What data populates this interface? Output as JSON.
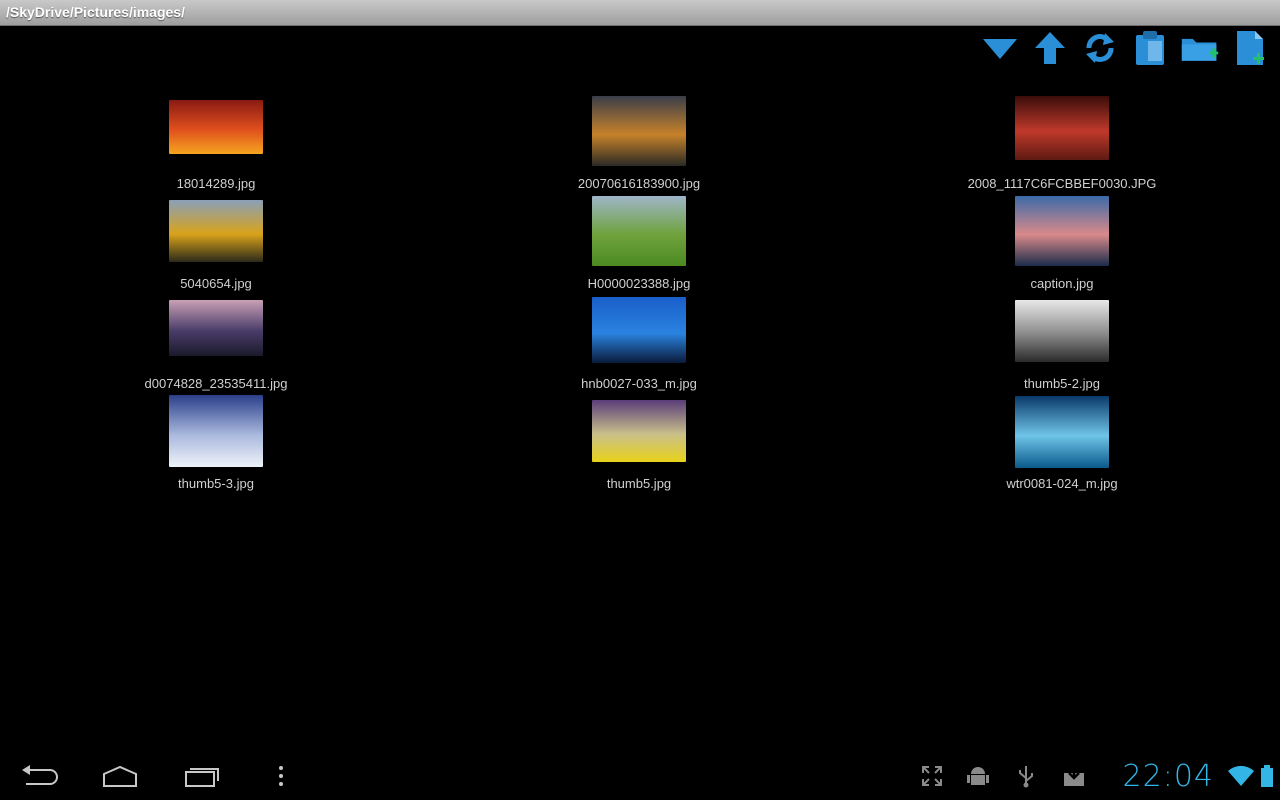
{
  "window": {
    "path": "/SkyDrive/Pictures/images/"
  },
  "toolbar": {
    "buttons": [
      {
        "name": "menu-dropdown-button",
        "icon": "triangle-down-icon"
      },
      {
        "name": "go-up-button",
        "icon": "arrow-up-icon"
      },
      {
        "name": "refresh-button",
        "icon": "refresh-icon"
      },
      {
        "name": "paste-button",
        "icon": "clipboard-icon"
      },
      {
        "name": "new-folder-button",
        "icon": "folder-add-icon"
      },
      {
        "name": "new-file-button",
        "icon": "file-add-icon"
      }
    ],
    "accent": "#2a8fd6"
  },
  "files": [
    {
      "name": "18014289.jpg",
      "colors": [
        "#8a1a12",
        "#e0501e",
        "#f6a51f"
      ]
    },
    {
      "name": "20070616183900.jpg",
      "colors": [
        "#3a3d4a",
        "#c7822a",
        "#2b2a25"
      ]
    },
    {
      "name": "2008_1117C6FCBBEF0030.JPG",
      "colors": [
        "#3a0d0a",
        "#c0392b",
        "#5d1a12"
      ]
    },
    {
      "name": "5040654.jpg",
      "colors": [
        "#8aa0b8",
        "#d9a21a",
        "#2b2a1a"
      ]
    },
    {
      "name": "H0000023388.jpg",
      "colors": [
        "#9fb5c9",
        "#6fa23c",
        "#4c8a22"
      ]
    },
    {
      "name": "caption.jpg",
      "colors": [
        "#3b6aa8",
        "#d98a8a",
        "#1b2b4a"
      ]
    },
    {
      "name": "d0074828_23535411.jpg",
      "colors": [
        "#c9a0b5",
        "#4a3d6a",
        "#1a1a2a"
      ]
    },
    {
      "name": "hnb0027-033_m.jpg",
      "colors": [
        "#1a5ec9",
        "#2a83e0",
        "#0a1a3a"
      ]
    },
    {
      "name": "thumb5-2.jpg",
      "colors": [
        "#e8e8e8",
        "#8a8a8a",
        "#2a2a2a"
      ]
    },
    {
      "name": "thumb5-3.jpg",
      "colors": [
        "#2b3f8a",
        "#a9b8dd",
        "#eef2f8"
      ]
    },
    {
      "name": "thumb5.jpg",
      "colors": [
        "#5a3d7a",
        "#c9c08a",
        "#e8d21a"
      ]
    },
    {
      "name": "wtr0081-024_m.jpg",
      "colors": [
        "#0a3a6a",
        "#6fc4e8",
        "#0a5a8a"
      ]
    }
  ],
  "statusbar": {
    "time": "22:04"
  },
  "navbar": {
    "buttons": [
      {
        "name": "back-button",
        "icon": "back-icon"
      },
      {
        "name": "home-button",
        "icon": "home-icon"
      },
      {
        "name": "recent-apps-button",
        "icon": "recent-apps-icon"
      },
      {
        "name": "menu-button",
        "icon": "overflow-menu-icon"
      }
    ]
  }
}
